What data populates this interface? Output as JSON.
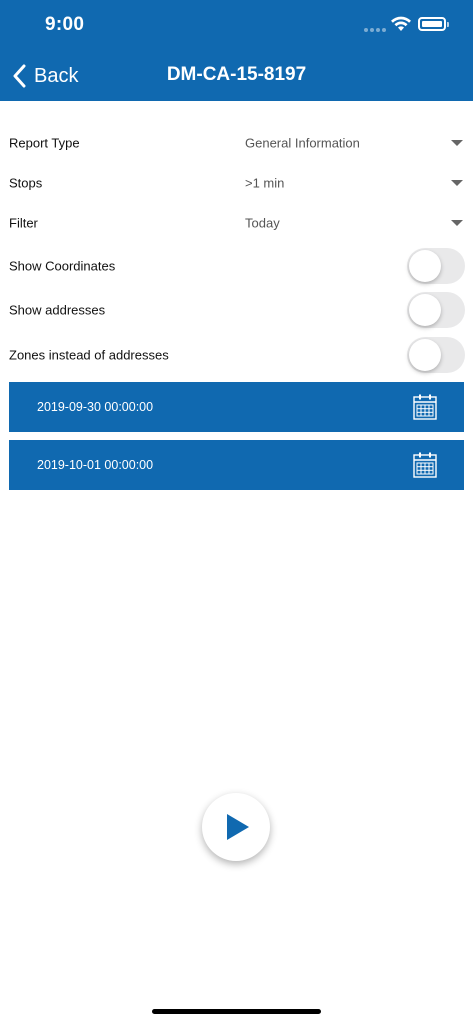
{
  "status_bar": {
    "time": "9:00"
  },
  "nav": {
    "back_label": "Back",
    "title": "DM-CA-15-8197"
  },
  "form": {
    "report_type": {
      "label": "Report Type",
      "value": "General Information"
    },
    "stops": {
      "label": "Stops",
      "value": ">1 min"
    },
    "filter": {
      "label": "Filter",
      "value": "Today"
    },
    "show_coordinates": {
      "label": "Show Coordinates",
      "on": false
    },
    "show_addresses": {
      "label": "Show addresses",
      "on": false
    },
    "zones_instead": {
      "label": "Zones instead of addresses",
      "on": false
    }
  },
  "dates": {
    "start": "2019-09-30 00:00:00",
    "end": "2019-10-01 00:00:00"
  },
  "icons": {
    "back": "chevron-left-icon",
    "calendar": "calendar-icon",
    "play": "play-icon",
    "wifi": "wifi-icon",
    "battery": "battery-icon"
  },
  "colors": {
    "primary": "#1069b0",
    "toggle_off": "#e9e9ea"
  }
}
